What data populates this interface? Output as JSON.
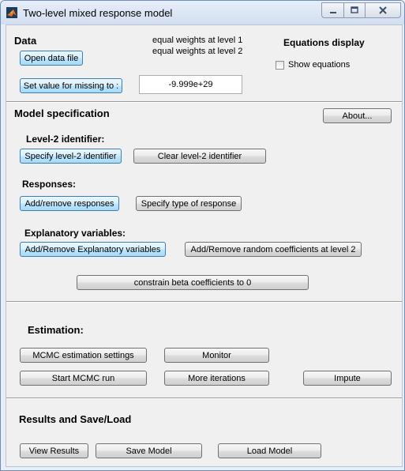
{
  "window": {
    "title": "Two-level mixed response model",
    "icon": "matlab-icon"
  },
  "data_section": {
    "heading": "Data",
    "open_button": "Open data file",
    "weights_level1": "equal weights at level 1",
    "weights_level2": "equal weights at level 2",
    "missing_button": "Set value for missing to :",
    "missing_value": "-9.999e+29"
  },
  "equations": {
    "heading": "Equations display",
    "checkbox_label": "Show equations",
    "checked": false
  },
  "model_section": {
    "heading": "Model specification",
    "about_button": "About...",
    "level2_heading": "Level-2 identifier:",
    "specify_level2_button": "Specify level-2 identifier",
    "clear_level2_button": "Clear level-2 identifier",
    "responses_heading": "Responses:",
    "add_remove_responses_button": "Add/remove responses",
    "specify_type_button": "Specify type of response",
    "explanatory_heading": "Explanatory variables:",
    "add_remove_explanatory_button": "Add/Remove Explanatory variables",
    "random_coeff_button": "Add/Remove random coefficients at level 2",
    "constrain_button": "constrain beta coefficients to 0"
  },
  "estimation_section": {
    "heading": "Estimation:",
    "mcmc_settings_button": "MCMC estimation settings",
    "monitor_button": "Monitor",
    "start_mcmc_button": "Start MCMC run",
    "more_iterations_button": "More iterations",
    "impute_button": "Impute"
  },
  "results_section": {
    "heading": "Results and Save/Load",
    "view_results_button": "View Results",
    "save_model_button": "Save Model",
    "load_model_button": "Load Model"
  }
}
